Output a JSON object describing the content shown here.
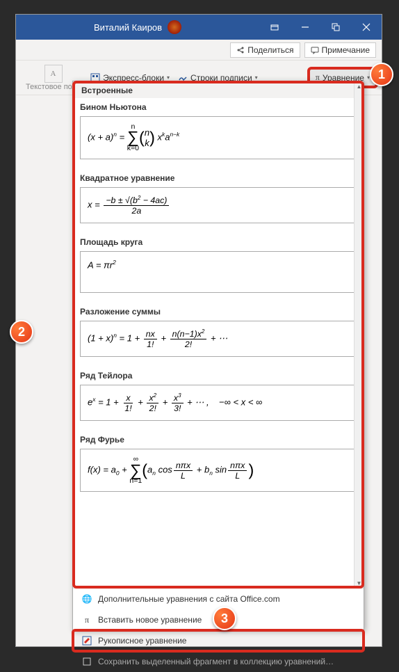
{
  "titlebar": {
    "user": "Виталий Каиров"
  },
  "ribbon": {
    "share_label": "Поделиться",
    "comment_label": "Примечание"
  },
  "toolbar": {
    "textbox_label": "Текстовое поле",
    "quickparts_label": "Экспресс-блоки",
    "signature_label": "Строки подписи",
    "equation_label": "Уравнение"
  },
  "gallery": {
    "section": "Встроенные",
    "items": [
      {
        "name": "Бином Ньютона"
      },
      {
        "name": "Квадратное уравнение"
      },
      {
        "name": "Площадь круга"
      },
      {
        "name": "Разложение суммы"
      },
      {
        "name": "Ряд Тейлора"
      },
      {
        "name": "Ряд Фурье"
      }
    ],
    "footer": {
      "more": "Дополнительные уравнения с сайта Office.com",
      "insert": "Вставить новое уравнение",
      "ink": "Рукописное уравнение",
      "save": "Сохранить выделенный фрагмент в коллекцию уравнений…"
    }
  },
  "callouts": {
    "c1": "1",
    "c2": "2",
    "c3": "3"
  }
}
